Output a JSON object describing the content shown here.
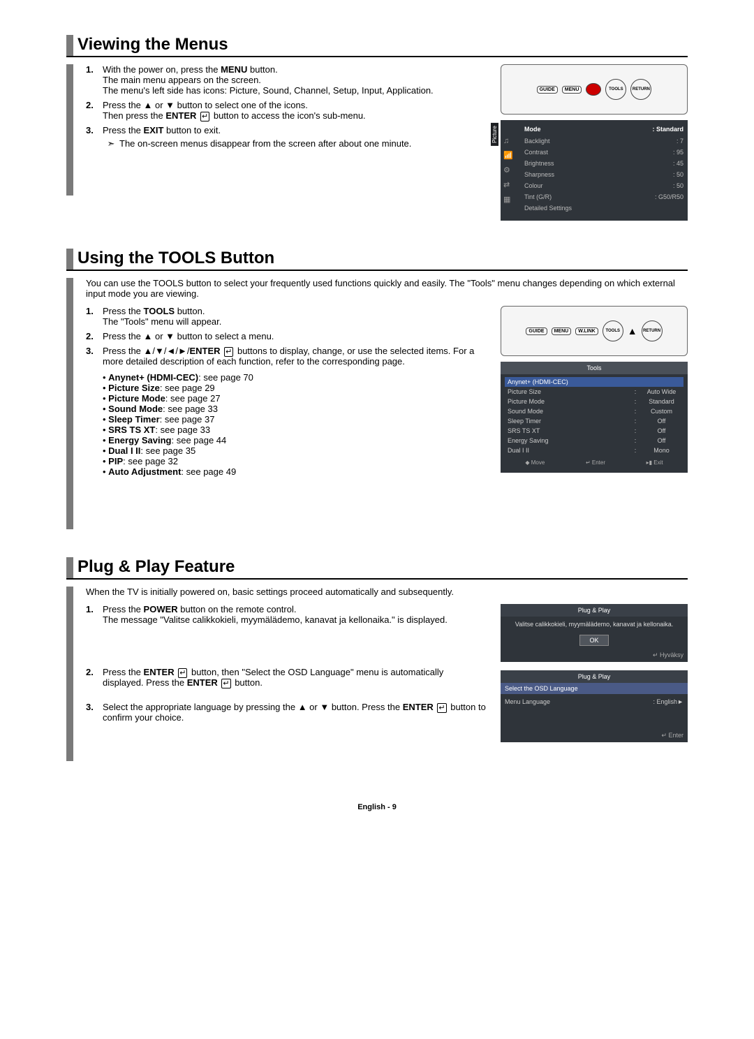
{
  "sections": {
    "viewing": {
      "title": "Viewing the Menus",
      "steps": {
        "s1": "With the power on, press the MENU button.\nThe main menu appears on the screen.\nThe menu's left side has icons: Picture, Sound, Channel, Setup, Input, Application.",
        "s2": "Press the ▲ or ▼ button to select one of the icons.\nThen press the ENTER ↵ button to access the icon's sub-menu.",
        "s3": "Press the EXIT button to exit.",
        "note": "The on-screen menus disappear from the screen after about one minute."
      }
    },
    "tools": {
      "title": "Using the TOOLS Button",
      "intro": "You can use the TOOLS button to select your frequently used functions quickly and easily. The \"Tools\" menu changes depending on which external input mode you are viewing.",
      "steps": {
        "s1": "Press the TOOLS button.\nThe \"Tools\" menu will appear.",
        "s2": "Press the ▲ or ▼ button to select a menu.",
        "s3": "Press the ▲/▼/◄/►/ENTER ↵ buttons to display, change, or use the selected items. For a more detailed description of each function, refer to the corresponding page."
      },
      "items": [
        {
          "name": "Anynet+ (HDMI-CEC)",
          "page": "see page 70"
        },
        {
          "name": "Picture Size",
          "page": "see page 29"
        },
        {
          "name": "Picture Mode",
          "page": "see page 27"
        },
        {
          "name": "Sound Mode",
          "page": "see page 33"
        },
        {
          "name": "Sleep Timer",
          "page": "see page 37"
        },
        {
          "name": "SRS TS XT",
          "page": "see page 33"
        },
        {
          "name": "Energy Saving",
          "page": "see page 44"
        },
        {
          "name": "Dual I II",
          "page": "see page 35"
        },
        {
          "name": "PIP",
          "page": "see page 32"
        },
        {
          "name": "Auto Adjustment",
          "page": "see page 49"
        }
      ]
    },
    "pnp": {
      "title": "Plug & Play Feature",
      "intro": "When the TV is initially powered on, basic settings proceed automatically and subsequently.",
      "steps": {
        "s1": "Press the POWER button on the remote control.\nThe message \"Valitse calikkokieli, myymälädemo, kanavat ja kellonaika.\" is displayed.",
        "s2": "Press the ENTER ↵ button, then \"Select the OSD Language\" menu is automatically displayed. Press the ENTER ↵ button.",
        "s3": "Select the appropriate language by pressing the ▲ or ▼ button. Press the ENTER ↵ button to confirm your choice."
      }
    }
  },
  "remote": {
    "guide": "GUIDE",
    "menu": "MENU",
    "wlink": "W.LINK",
    "tools": "TOOLS",
    "return": "RETURN"
  },
  "osd_picture": {
    "tab": "Picture",
    "mode_label": "Mode",
    "mode_value": "Standard",
    "rows": [
      {
        "label": "Backlight",
        "value": "7"
      },
      {
        "label": "Contrast",
        "value": "95"
      },
      {
        "label": "Brightness",
        "value": "45"
      },
      {
        "label": "Sharpness",
        "value": "50"
      },
      {
        "label": "Colour",
        "value": "50"
      },
      {
        "label": "Tint (G/R)",
        "value": "G50/R50"
      },
      {
        "label": "Detailed Settings",
        "value": ""
      }
    ]
  },
  "osd_tools": {
    "title": "Tools",
    "highlight": "Anynet+ (HDMI-CEC)",
    "rows": [
      {
        "l": "Picture Size",
        "r": "Auto Wide"
      },
      {
        "l": "Picture Mode",
        "r": "Standard"
      },
      {
        "l": "Sound Mode",
        "r": "Custom"
      },
      {
        "l": "Sleep Timer",
        "r": "Off"
      },
      {
        "l": "SRS TS XT",
        "r": "Off"
      },
      {
        "l": "Energy Saving",
        "r": "Off"
      },
      {
        "l": "Dual I II",
        "r": "Mono"
      }
    ],
    "foot": {
      "move": "◆ Move",
      "enter": "↵ Enter",
      "exit": "▸▮ Exit"
    }
  },
  "osd_pnp1": {
    "title": "Plug & Play",
    "msg": "Valitse calikkokieli, myymälädemo, kanavat ja kellonaika.",
    "ok": "OK",
    "foot": "↵ Hyväksy"
  },
  "osd_pnp2": {
    "title": "Plug & Play",
    "subtitle": "Select the OSD Language",
    "lang_label": "Menu Language",
    "lang_value": "English",
    "foot": "↵ Enter"
  },
  "footer": "English - 9"
}
